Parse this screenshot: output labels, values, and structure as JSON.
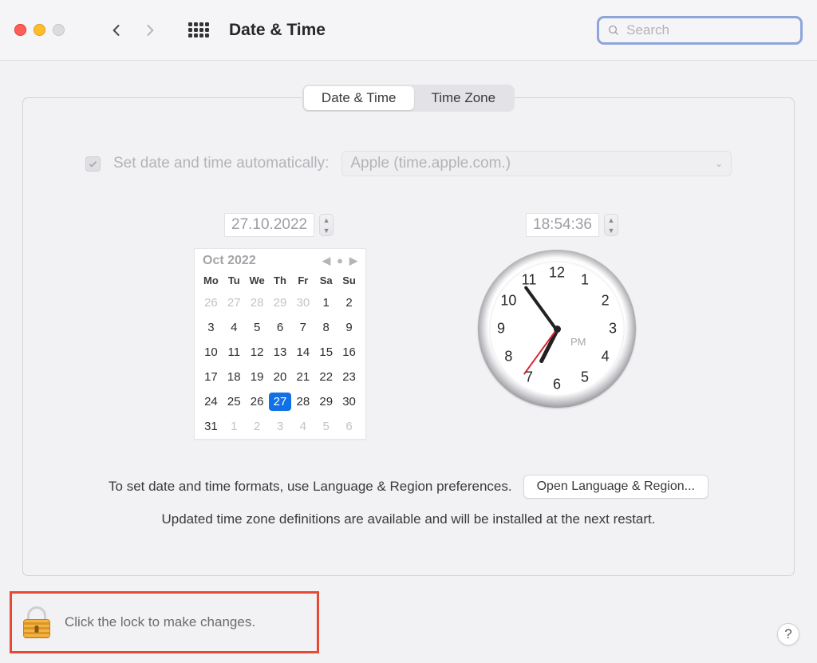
{
  "toolbar": {
    "title": "Date & Time",
    "search_placeholder": "Search"
  },
  "tabs": {
    "date_time": "Date & Time",
    "time_zone": "Time Zone"
  },
  "auto": {
    "label": "Set date and time automatically:",
    "server": "Apple (time.apple.com.)"
  },
  "fields": {
    "date": "27.10.2022",
    "time": "18:54:36"
  },
  "calendar": {
    "month_label": "Oct 2022",
    "dow": [
      "Mo",
      "Tu",
      "We",
      "Th",
      "Fr",
      "Sa",
      "Su"
    ],
    "rows": [
      [
        {
          "n": "26",
          "o": true
        },
        {
          "n": "27",
          "o": true
        },
        {
          "n": "28",
          "o": true
        },
        {
          "n": "29",
          "o": true
        },
        {
          "n": "30",
          "o": true
        },
        {
          "n": "1"
        },
        {
          "n": "2"
        }
      ],
      [
        {
          "n": "3"
        },
        {
          "n": "4"
        },
        {
          "n": "5"
        },
        {
          "n": "6"
        },
        {
          "n": "7"
        },
        {
          "n": "8"
        },
        {
          "n": "9"
        }
      ],
      [
        {
          "n": "10"
        },
        {
          "n": "11"
        },
        {
          "n": "12"
        },
        {
          "n": "13"
        },
        {
          "n": "14"
        },
        {
          "n": "15"
        },
        {
          "n": "16"
        }
      ],
      [
        {
          "n": "17"
        },
        {
          "n": "18"
        },
        {
          "n": "19"
        },
        {
          "n": "20"
        },
        {
          "n": "21"
        },
        {
          "n": "22"
        },
        {
          "n": "23"
        }
      ],
      [
        {
          "n": "24"
        },
        {
          "n": "25"
        },
        {
          "n": "26"
        },
        {
          "n": "27",
          "sel": true
        },
        {
          "n": "28"
        },
        {
          "n": "29"
        },
        {
          "n": "30"
        }
      ],
      [
        {
          "n": "31"
        },
        {
          "n": "1",
          "o": true
        },
        {
          "n": "2",
          "o": true
        },
        {
          "n": "3",
          "o": true
        },
        {
          "n": "4",
          "o": true
        },
        {
          "n": "5",
          "o": true
        },
        {
          "n": "6",
          "o": true
        }
      ]
    ]
  },
  "clock": {
    "ampm": "PM",
    "hour": 6,
    "minute": 54,
    "second": 36,
    "numerals": [
      "12",
      "1",
      "2",
      "3",
      "4",
      "5",
      "6",
      "7",
      "8",
      "9",
      "10",
      "11"
    ]
  },
  "footer": {
    "line1": "To set date and time formats, use Language & Region preferences.",
    "button": "Open Language & Region...",
    "line2": "Updated time zone definitions are available and will be installed at the next restart."
  },
  "lock": {
    "text": "Click the lock to make changes."
  },
  "help": {
    "label": "?"
  }
}
